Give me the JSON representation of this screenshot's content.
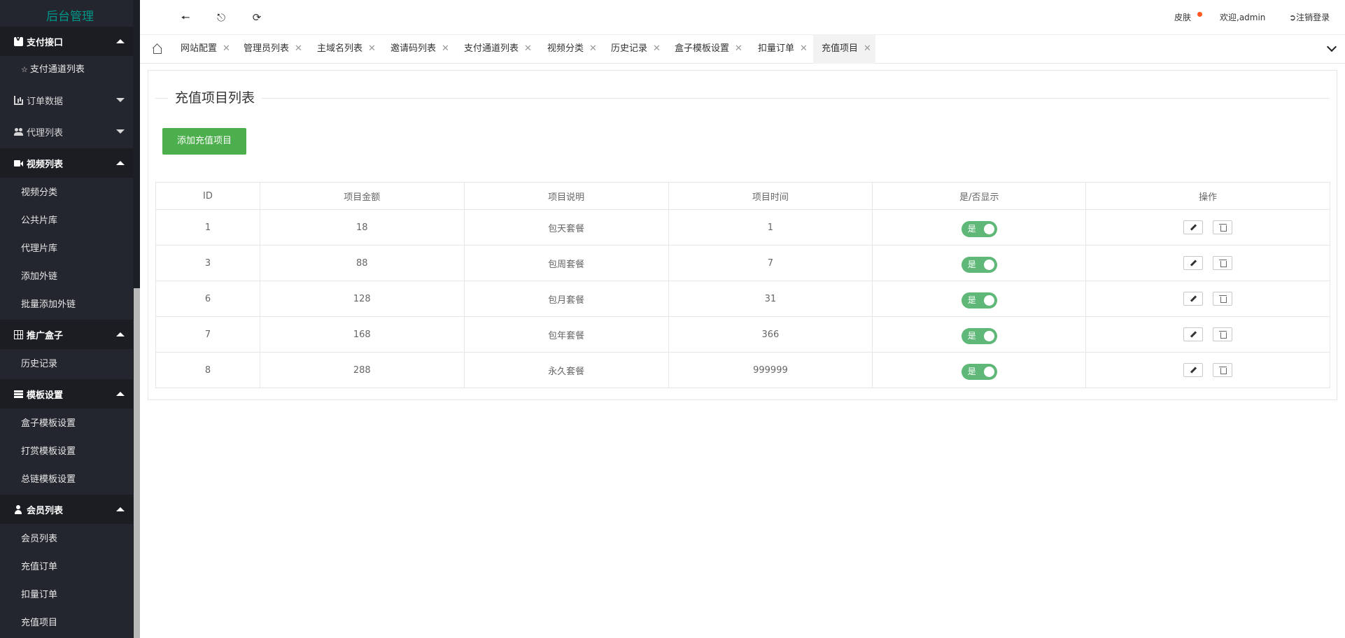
{
  "sidebar": {
    "logo": "后台管理",
    "groups": [
      {
        "label": "支付接口",
        "icon": "shield-v-icon",
        "state": "open"
      },
      {
        "label": "订单数据",
        "icon": "bar-chart-icon",
        "state": "closed"
      },
      {
        "label": "代理列表",
        "icon": "users-icon",
        "state": "closed"
      },
      {
        "label": "视频列表",
        "icon": "video-camera-icon",
        "state": "open"
      },
      {
        "label": "推广盒子",
        "icon": "table-grid-icon",
        "state": "open"
      },
      {
        "label": "模板设置",
        "icon": "server-icon",
        "state": "open"
      },
      {
        "label": "会员列表",
        "icon": "user-icon",
        "state": "open"
      }
    ],
    "items": {
      "pay": [
        "支付通道列表"
      ],
      "video": [
        "视频分类",
        "公共片库",
        "代理片库",
        "添加外链",
        "批量添加外链"
      ],
      "box": [
        "历史记录"
      ],
      "tpl": [
        "盒子模板设置",
        "打赏模板设置",
        "总链模板设置"
      ],
      "member": [
        "会员列表",
        "充值订单",
        "扣量订单",
        "充值项目"
      ]
    }
  },
  "header": {
    "skin": "皮肤",
    "welcome": "欢迎,admin",
    "logout": "注销登录"
  },
  "tabs": [
    "网站配置",
    "管理员列表",
    "主域名列表",
    "邀请码列表",
    "支付通道列表",
    "视频分类",
    "历史记录",
    "盒子模板设置",
    "扣量订单",
    "充值项目"
  ],
  "active_tab": 9,
  "page": {
    "title": "充值项目列表",
    "add_button": "添加充值项目"
  },
  "table": {
    "columns": [
      "ID",
      "项目金额",
      "项目说明",
      "项目时间",
      "是/否显示",
      "操作"
    ],
    "rows": [
      {
        "id": "1",
        "amount": "18",
        "desc": "包天套餐",
        "time": "1",
        "show": "是"
      },
      {
        "id": "3",
        "amount": "88",
        "desc": "包周套餐",
        "time": "7",
        "show": "是"
      },
      {
        "id": "6",
        "amount": "128",
        "desc": "包月套餐",
        "time": "31",
        "show": "是"
      },
      {
        "id": "7",
        "amount": "168",
        "desc": "包年套餐",
        "time": "366",
        "show": "是"
      },
      {
        "id": "8",
        "amount": "288",
        "desc": "永久套餐",
        "time": "999999",
        "show": "是"
      }
    ]
  },
  "colors": {
    "sidebar_bg": "#23262e",
    "logo": "#009688",
    "button_green": "#4cae4c",
    "switch_green": "#5fb878",
    "dot": "#ff5722"
  }
}
